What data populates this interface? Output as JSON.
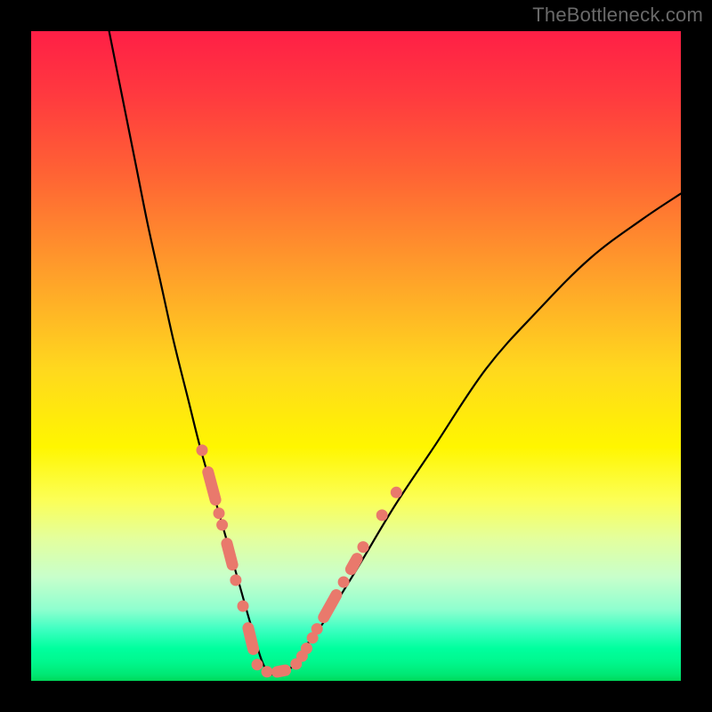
{
  "watermark": "TheBottleneck.com",
  "colors": {
    "frame": "#000000",
    "gradient_top": "#ff1f46",
    "gradient_mid": "#fff600",
    "gradient_bottom": "#00d85a",
    "curve": "#000000",
    "dots": "#e9796c"
  },
  "chart_data": {
    "type": "line",
    "title": "",
    "xlabel": "",
    "ylabel": "",
    "xlim": [
      0,
      100
    ],
    "ylim": [
      0,
      100
    ],
    "notes": "V-shaped bottleneck curve over a vertical red-to-green gradient. Minimum near x≈34 at y≈0. Pink dot/segment markers cluster along the low portion of both branches.",
    "series": [
      {
        "name": "curve",
        "x": [
          12,
          14,
          16,
          18,
          20,
          22,
          24,
          26,
          28,
          30,
          32,
          34,
          36,
          38,
          40,
          42,
          45,
          50,
          56,
          62,
          70,
          78,
          86,
          94,
          100
        ],
        "y": [
          100,
          90,
          80,
          70,
          61,
          52,
          44,
          36,
          29,
          22,
          15,
          8,
          2,
          1,
          2,
          5,
          9,
          17,
          27,
          36,
          48,
          57,
          65,
          71,
          75
        ]
      }
    ],
    "markers": [
      {
        "type": "dot",
        "x": 26.3,
        "y": 35.5
      },
      {
        "type": "seg",
        "x1": 27.0,
        "y1": 33.0,
        "x2": 28.6,
        "y2": 27.0
      },
      {
        "type": "dot",
        "x": 28.9,
        "y": 25.8
      },
      {
        "type": "dot",
        "x": 29.4,
        "y": 24.0
      },
      {
        "type": "seg",
        "x1": 29.9,
        "y1": 22.0,
        "x2": 31.2,
        "y2": 17.0
      },
      {
        "type": "dot",
        "x": 31.5,
        "y": 15.5
      },
      {
        "type": "dot",
        "x": 32.6,
        "y": 11.5
      },
      {
        "type": "seg",
        "x1": 33.2,
        "y1": 9.0,
        "x2": 34.4,
        "y2": 4.0
      },
      {
        "type": "dot",
        "x": 34.8,
        "y": 2.5
      },
      {
        "type": "dot",
        "x": 36.3,
        "y": 1.4
      },
      {
        "type": "seg",
        "x1": 37.0,
        "y1": 1.2,
        "x2": 40.0,
        "y2": 1.8
      },
      {
        "type": "dot",
        "x": 40.8,
        "y": 2.6
      },
      {
        "type": "dot",
        "x": 41.7,
        "y": 3.8
      },
      {
        "type": "dot",
        "x": 42.4,
        "y": 5.0
      },
      {
        "type": "dot",
        "x": 43.3,
        "y": 6.6
      },
      {
        "type": "dot",
        "x": 44.0,
        "y": 8.0
      },
      {
        "type": "seg",
        "x1": 44.6,
        "y1": 9.0,
        "x2": 47.4,
        "y2": 14.0
      },
      {
        "type": "dot",
        "x": 48.1,
        "y": 15.2
      },
      {
        "type": "seg",
        "x1": 48.8,
        "y1": 16.4,
        "x2": 50.6,
        "y2": 19.6
      },
      {
        "type": "dot",
        "x": 51.1,
        "y": 20.6
      },
      {
        "type": "dot",
        "x": 54.0,
        "y": 25.5
      },
      {
        "type": "dot",
        "x": 56.2,
        "y": 29.0
      }
    ]
  }
}
